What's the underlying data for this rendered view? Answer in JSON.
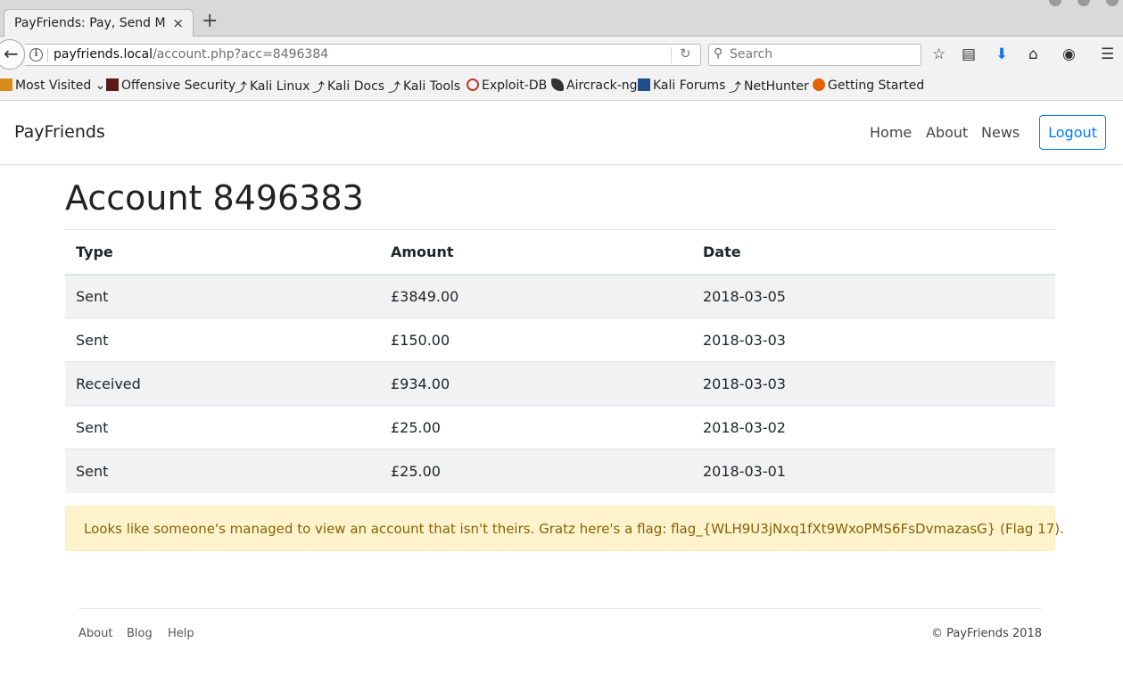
{
  "browser": {
    "tab_title": "PayFriends: Pay, Send M…",
    "tab_close": "×",
    "new_tab": "+",
    "url_host": "payfriends.local",
    "url_path": "/account.php?acc=8496384",
    "search_placeholder": "Search",
    "bookmarks": [
      {
        "label": "Most Visited",
        "icon": "folder-icon",
        "color": "#d98a1a"
      },
      {
        "label": "Offensive Security",
        "icon": "offsec-icon",
        "color": "#5a1a1a"
      },
      {
        "label": "Kali Linux",
        "icon": "kali-dragon-icon",
        "color": "#222222"
      },
      {
        "label": "Kali Docs",
        "icon": "kali-dragon-icon",
        "color": "#222222"
      },
      {
        "label": "Kali Tools",
        "icon": "kali-dragon-icon",
        "color": "#222222"
      },
      {
        "label": "Exploit-DB",
        "icon": "exploitdb-icon",
        "color": "#c0392b"
      },
      {
        "label": "Aircrack-ng",
        "icon": "aircrack-icon",
        "color": "#333333"
      },
      {
        "label": "Kali Forums",
        "icon": "kali-forums-icon",
        "color": "#1f4e8a"
      },
      {
        "label": "NetHunter",
        "icon": "kali-dragon-icon",
        "color": "#222222"
      },
      {
        "label": "Getting Started",
        "icon": "firefox-icon",
        "color": "#e66000"
      }
    ]
  },
  "site": {
    "brand": "PayFriends",
    "nav": {
      "home": "Home",
      "about": "About",
      "news": "News",
      "logout": "Logout"
    },
    "title": "Account 8496383",
    "table": {
      "headers": [
        "Type",
        "Amount",
        "Date"
      ],
      "rows": [
        [
          "Sent",
          "£3849.00",
          "2018-03-05"
        ],
        [
          "Sent",
          "£150.00",
          "2018-03-03"
        ],
        [
          "Received",
          "£934.00",
          "2018-03-03"
        ],
        [
          "Sent",
          "£25.00",
          "2018-03-02"
        ],
        [
          "Sent",
          "£25.00",
          "2018-03-01"
        ]
      ]
    },
    "alert": "Looks like someone's managed to view an account that isn't theirs. Gratz here's a flag: flag_{WLH9U3jNxq1fXt9WxoPMS6FsDvmazasG} (Flag 17).",
    "footer": {
      "about": "About",
      "blog": "Blog",
      "help": "Help",
      "copyright": "© PayFriends 2018"
    }
  },
  "colors": {
    "accent": "#007bff",
    "alert_bg": "#fff3cd",
    "alert_text": "#856404",
    "stripe": "#f2f2f2"
  }
}
